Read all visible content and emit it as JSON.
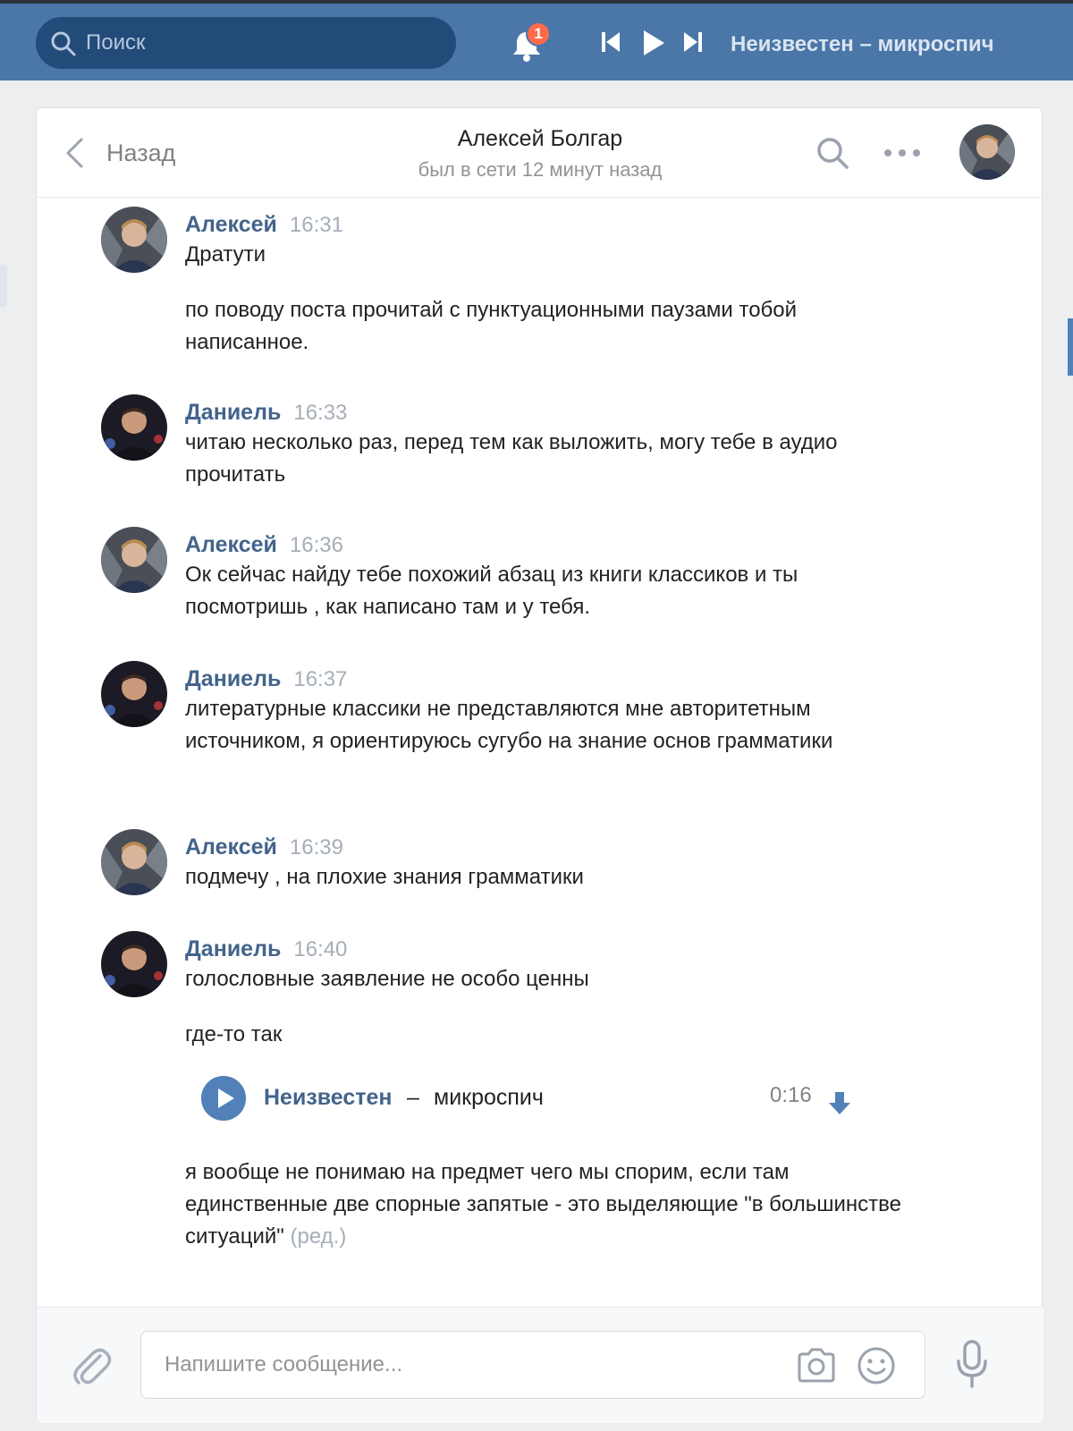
{
  "topbar": {
    "search_placeholder": "Поиск",
    "notification_count": "1",
    "now_playing": "Неизвестен – микроспич"
  },
  "chat": {
    "back_label": "Назад",
    "title": "Алексей Болгар",
    "status": "был в сети 12 минут назад"
  },
  "messages": [
    {
      "author": "Алексей",
      "time": "16:31",
      "lines": [
        "Дратути"
      ],
      "second": "по поводу поста прочитай с пунктуационными паузами тобой написанное."
    },
    {
      "author": "Даниель",
      "time": "16:33",
      "text": "читаю несколько раз, перед тем как выложить, могу тебе в аудио прочитать"
    },
    {
      "author": "Алексей",
      "time": "16:36",
      "text": "Ок сейчас найду тебе похожий абзац из книги классиков и ты посмотришь , как написано там и у тебя."
    },
    {
      "author": "Даниель",
      "time": "16:37",
      "text": "литературные классики не представляются мне авторитетным источником, я ориентируюсь сугубо на знание основ грамматики"
    },
    {
      "author": "Алексей",
      "time": "16:39",
      "text": "подмечу , на плохие знания грамматики"
    },
    {
      "author": "Даниель",
      "time": "16:40",
      "text": "голословные заявление не особо ценны",
      "second": "где-то так",
      "audio": {
        "artist": "Неизвестен",
        "sep": "–",
        "title": "микроспич",
        "duration": "0:16"
      },
      "third": "я вообще не понимаю на предмет чего мы спорим, если там единственные две спорные запятые - это выделяющие \"в большинстве ситуаций\"",
      "edited": "(ред.)"
    }
  ],
  "composer": {
    "placeholder": "Напишите сообщение..."
  },
  "colors": {
    "topbar": "#4a76a8",
    "search_bg": "#224b7a",
    "author_name": "#42648b",
    "accent": "#5181b8",
    "badge": "#ff6b4a"
  },
  "icons": [
    "search-icon",
    "bell-icon",
    "previous-track-icon",
    "play-icon",
    "next-track-icon",
    "back-chevron-icon",
    "more-icon",
    "download-icon",
    "attach-icon",
    "camera-icon",
    "smile-icon",
    "microphone-icon"
  ]
}
